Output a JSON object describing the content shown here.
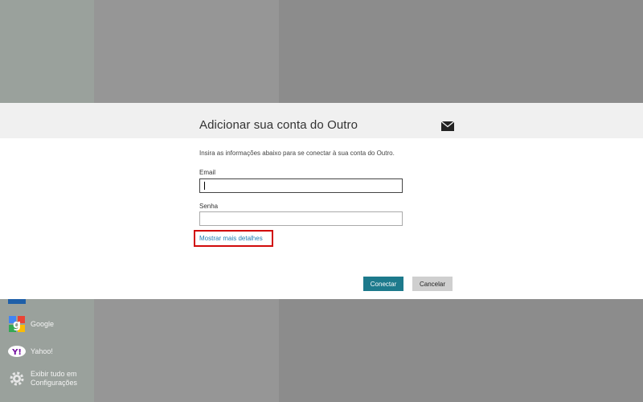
{
  "dialog": {
    "title": "Adicionar sua conta do Outro",
    "intro": "Insira as informações abaixo para se conectar à sua conta do Outro.",
    "email_label": "Email",
    "email_value": "",
    "senha_label": "Senha",
    "senha_value": "",
    "more_details_link": "Mostrar mais detalhes",
    "connect_button": "Conectar",
    "cancel_button": "Cancelar",
    "header_icon": "mail-icon",
    "highlight_color": "#d10b0b",
    "accent_color": "#1d7a8c"
  },
  "accounts": {
    "items": [
      {
        "label": "Google",
        "icon": "google-icon"
      },
      {
        "label": "Yahoo!",
        "icon": "yahoo-icon"
      },
      {
        "label": "Exibir tudo em Configurações",
        "label_line1": "Exibir tudo em",
        "label_line2": "Configurações",
        "icon": "gear-icon"
      }
    ]
  }
}
